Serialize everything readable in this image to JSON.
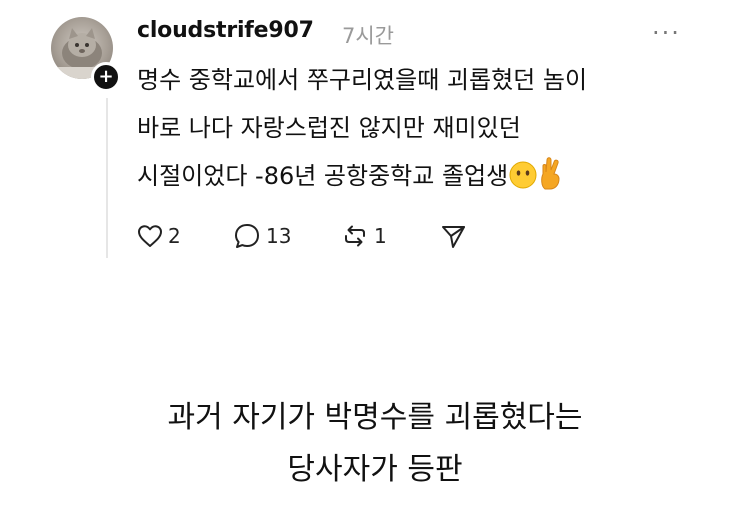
{
  "post": {
    "username": "cloudstrife907",
    "time": "7시간",
    "more_label": "···",
    "body": "명수 중학교에서 쭈구리였을때 괴롭혔던 놈이\n바로 나다 자랑스럽진 않지만 재미있던\n시절이었다 -86년 공항중학교 졸업생",
    "emojis": [
      "face-without-mouth",
      "crossed-fingers"
    ],
    "actions": {
      "like_count": "2",
      "comment_count": "13",
      "repost_count": "1"
    }
  },
  "caption": "과거 자기가 박명수를 괴롭혔다는\n당사자가 등판",
  "colors": {
    "text": "#111111",
    "muted": "#9a9a9a",
    "thread_line": "#e6e6e6"
  }
}
